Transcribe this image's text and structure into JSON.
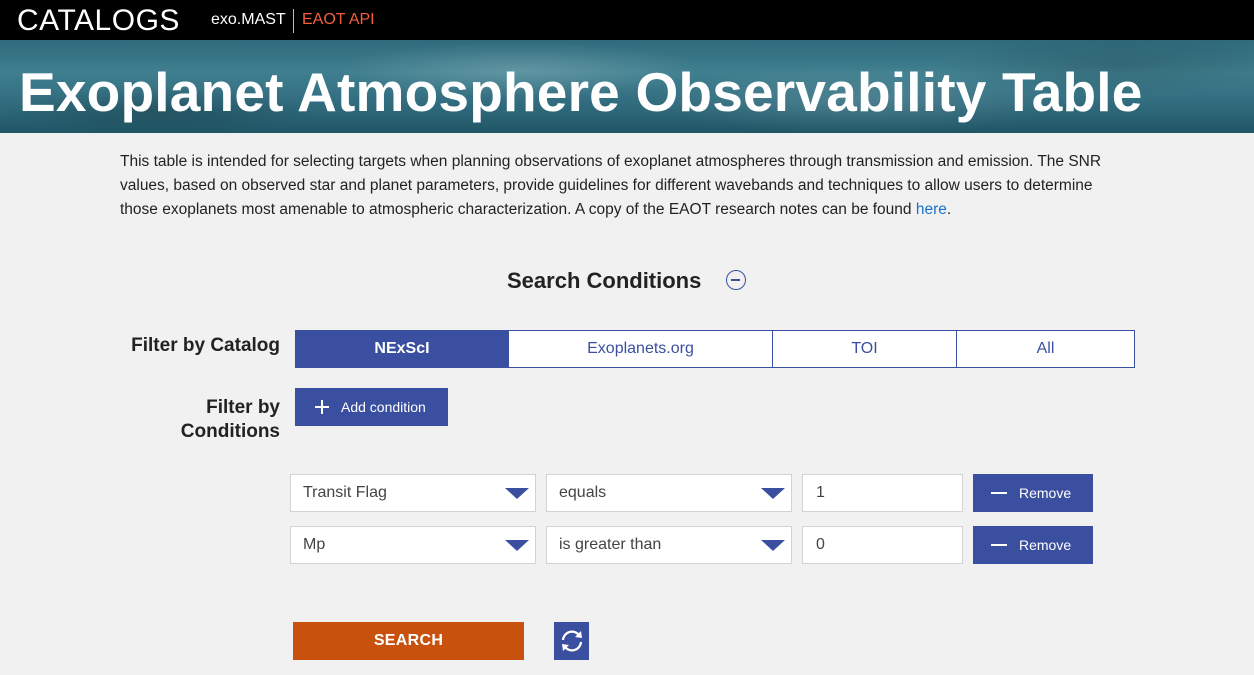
{
  "topnav": {
    "logo": "CATALOGS",
    "links": [
      {
        "label": "exo.MAST"
      },
      {
        "label": "EAOT API"
      }
    ]
  },
  "banner": {
    "title": "Exoplanet Atmosphere Observability Table"
  },
  "intro": {
    "text": "This table is intended for selecting targets when planning observations of exoplanet atmospheres through transmission and emission. The SNR values, based on observed star and planet parameters, provide guidelines for different wavebands and techniques to allow users to determine those exoplanets most amenable to atmospheric characterization. A copy of the EAOT research notes can be found ",
    "link_label": "here",
    "trailing": "."
  },
  "search_conditions": {
    "heading": "Search Conditions",
    "toggle_icon": "collapse-circle-icon"
  },
  "catalog_filter": {
    "label": "Filter by Catalog",
    "tabs": [
      {
        "label": "NExScI",
        "active": true
      },
      {
        "label": "Exoplanets.org",
        "active": false
      },
      {
        "label": "TOI",
        "active": false
      },
      {
        "label": "All",
        "active": false
      }
    ]
  },
  "conditions_filter": {
    "label": "Filter by Conditions",
    "add_button_label": "Add condition"
  },
  "conditions": [
    {
      "field": "Transit Flag",
      "operator": "equals",
      "value": "1",
      "remove_label": "Remove"
    },
    {
      "field": "Mp",
      "operator": "is greater than",
      "value": "0",
      "remove_label": "Remove"
    }
  ],
  "actions": {
    "search_label": "SEARCH",
    "reset_icon": "refresh-icon"
  },
  "colors": {
    "accent": "#3b4fa1",
    "search": "#c8520d",
    "api_link": "#f25f3b",
    "link": "#1a73c9"
  }
}
